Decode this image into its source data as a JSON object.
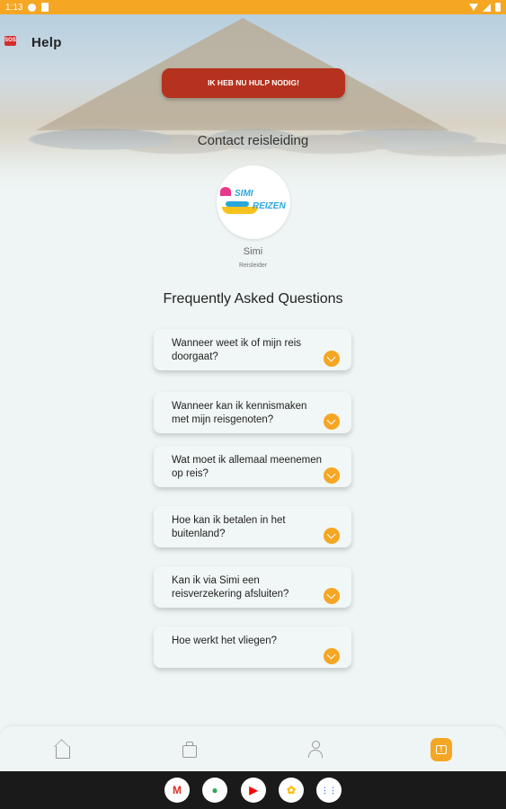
{
  "status_bar": {
    "time": "1:13"
  },
  "header": {
    "title": "Help",
    "sos_icon": "sos-icon",
    "sos_label": "SOS"
  },
  "help_button": {
    "label": "IK HEB NU HULP NODIG!"
  },
  "contact": {
    "title": "Contact reisleiding",
    "logo_line1": "SIMI",
    "logo_line2": "REIZEN",
    "name": "Simi",
    "role": "Reisleider"
  },
  "faq": {
    "heading": "Frequently Asked Questions",
    "items": [
      {
        "question": "Wanneer weet ik of mijn reis doorgaat?"
      },
      {
        "question": "Wanneer kan ik kennismaken met mijn reisgenoten?"
      },
      {
        "question": "Wat moet ik allemaal meenemen op reis?"
      },
      {
        "question": "Hoe kan ik betalen in het buitenland?"
      },
      {
        "question": "Kan ik via Simi een reisverzekering afsluiten?"
      },
      {
        "question": "Hoe werkt het vliegen?"
      }
    ]
  },
  "bottom_nav": {
    "items": [
      {
        "icon": "home-icon"
      },
      {
        "icon": "suitcase-icon"
      },
      {
        "icon": "profile-icon"
      },
      {
        "icon": "chat-icon",
        "active": true
      }
    ],
    "accent_color": "#f5a623"
  },
  "dock": {
    "apps": [
      {
        "icon": "gmail-icon",
        "glyph": "M"
      },
      {
        "icon": "chrome-icon",
        "glyph": "●"
      },
      {
        "icon": "youtube-icon",
        "glyph": "▶"
      },
      {
        "icon": "photos-icon",
        "glyph": "✿"
      },
      {
        "icon": "app-drawer-icon",
        "glyph": "⋮⋮"
      }
    ]
  },
  "colors": {
    "accent": "#f5a623",
    "emergency": "#b5321f",
    "background": "#eef5f4"
  }
}
